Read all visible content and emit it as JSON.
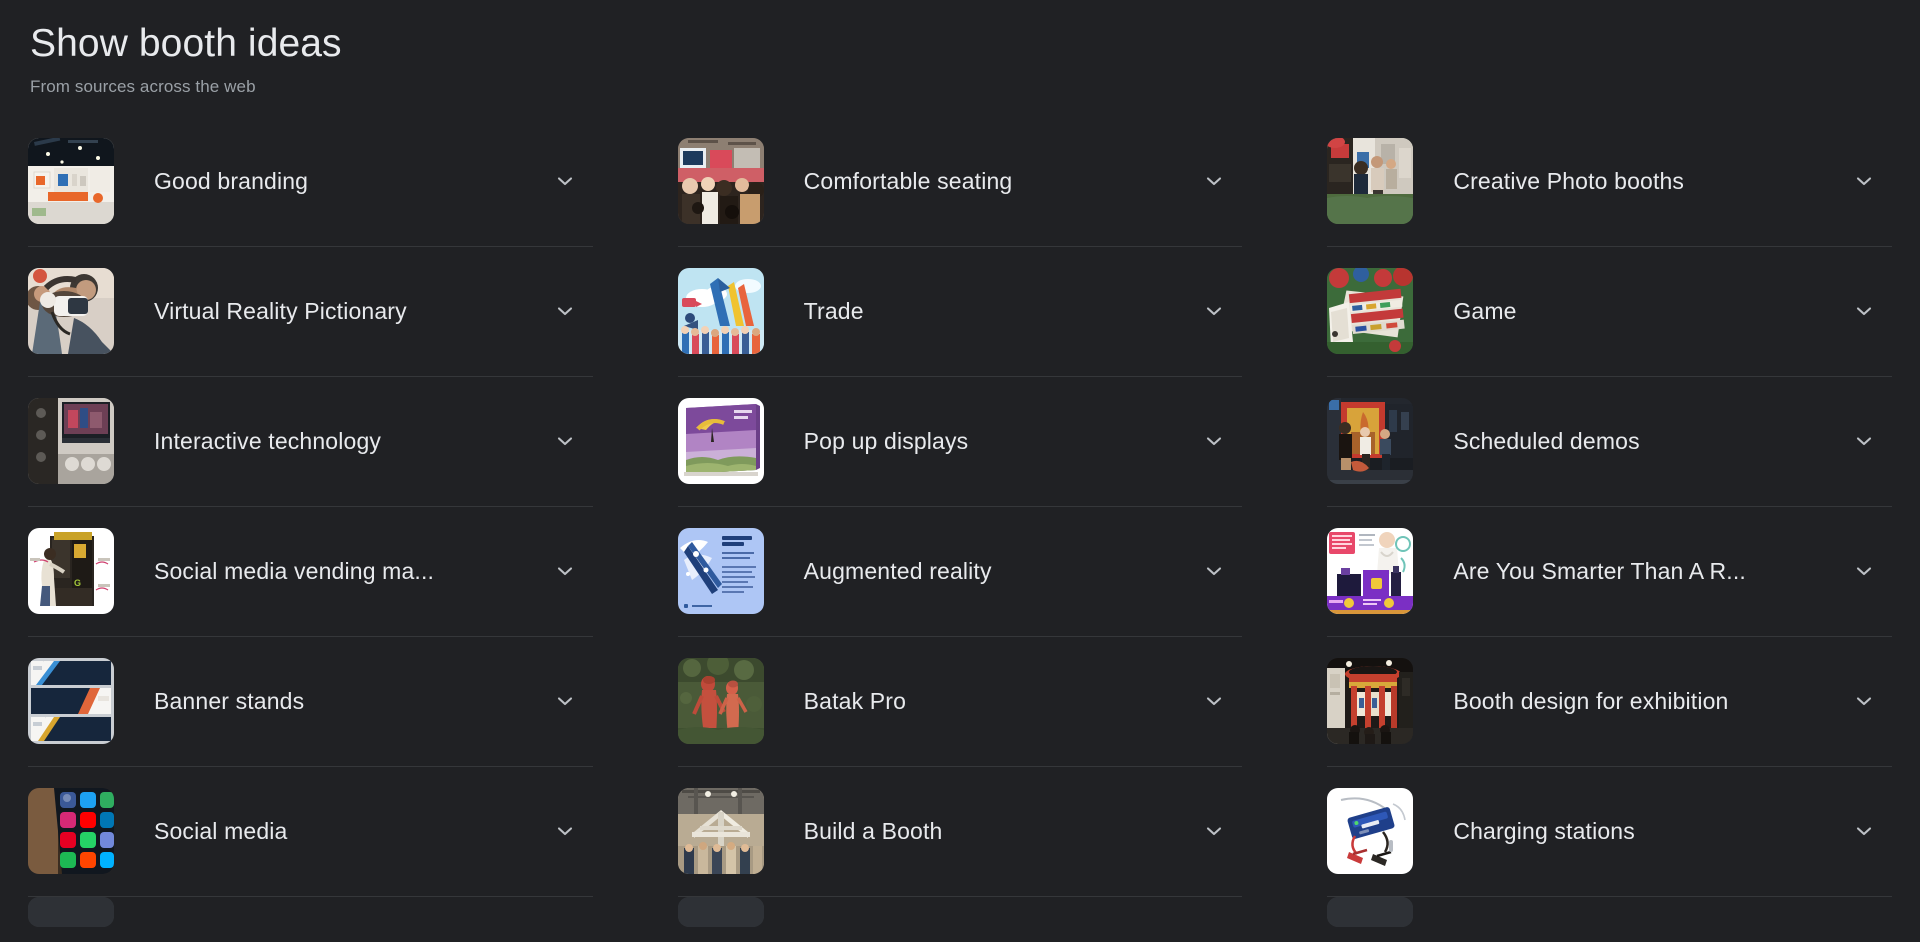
{
  "header": {
    "title": "Show booth ideas",
    "subtitle": "From sources across the web"
  },
  "colors": {
    "background": "#202124",
    "divider": "#35373a",
    "text_primary": "#e8eaed",
    "text_secondary": "#9aa0a6",
    "chevron": "#bdc1c6"
  },
  "icons": {
    "expand": "chevron-down-icon"
  },
  "columns": [
    {
      "items": [
        {
          "label": "Good branding",
          "thumb": "trade-show-booth-white-orange",
          "truncated": false
        },
        {
          "label": "Virtual Reality Pictionary",
          "thumb": "woman-wearing-vr-headset",
          "truncated": false
        },
        {
          "label": "Interactive technology",
          "thumb": "interactive-display-kiosk",
          "truncated": false
        },
        {
          "label": "Social media vending ma...",
          "thumb": "social-media-vending-machine",
          "truncated": true
        },
        {
          "label": "Banner stands",
          "thumb": "navy-banner-stand-designs",
          "truncated": false
        },
        {
          "label": "Social media",
          "thumb": "smartphone-social-app-icons",
          "truncated": false
        },
        {
          "label": "",
          "thumb": "partial-next-thumbnail",
          "truncated": false
        }
      ]
    },
    {
      "items": [
        {
          "label": "Comfortable seating",
          "thumb": "seated-audience-at-booth",
          "truncated": false
        },
        {
          "label": "Trade",
          "thumb": "illustrated-crowd-flags",
          "truncated": false
        },
        {
          "label": "Pop up displays",
          "thumb": "purple-popup-display-wall",
          "truncated": false
        },
        {
          "label": "Augmented reality",
          "thumb": "augmented-reality-blue-slide",
          "truncated": false
        },
        {
          "label": "Batak Pro",
          "thumb": "two-figures-in-greenery",
          "truncated": false
        },
        {
          "label": "Build a Booth",
          "thumb": "exhibition-hall-construction",
          "truncated": false
        },
        {
          "label": "",
          "thumb": "partial-next-thumbnail",
          "truncated": false
        }
      ]
    },
    {
      "items": [
        {
          "label": "Creative Photo booths",
          "thumb": "visitors-at-photo-booth",
          "truncated": false
        },
        {
          "label": "Game",
          "thumb": "tabletop-game-pieces",
          "truncated": false
        },
        {
          "label": "Scheduled demos",
          "thumb": "red-arch-demo-stage",
          "truncated": false
        },
        {
          "label": "Are You Smarter Than A R...",
          "thumb": "purple-quiz-game-booth",
          "truncated": true
        },
        {
          "label": "Booth design for exhibition",
          "thumb": "red-circular-booth-design",
          "truncated": false
        },
        {
          "label": "Charging stations",
          "thumb": "blue-battery-charger-clamps",
          "truncated": false
        },
        {
          "label": "",
          "thumb": "partial-next-thumbnail",
          "truncated": false
        }
      ]
    }
  ]
}
